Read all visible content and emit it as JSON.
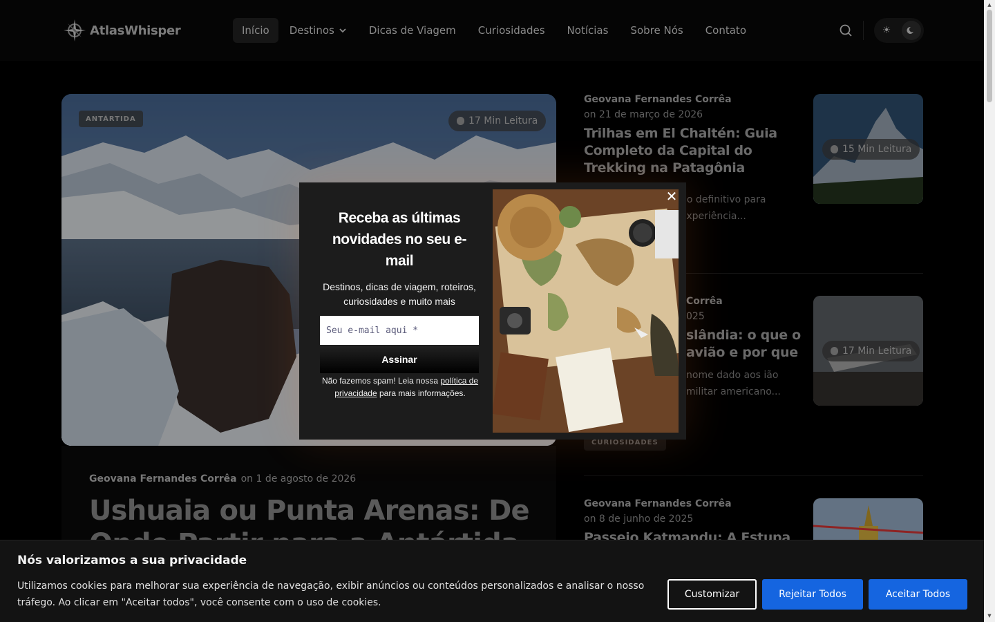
{
  "header": {
    "logo_text": "AtlasWhisper",
    "nav": [
      {
        "label": "Início",
        "active": true
      },
      {
        "label": "Destinos",
        "dropdown": true
      },
      {
        "label": "Dicas de Viagem"
      },
      {
        "label": "Curiosidades"
      },
      {
        "label": "Notícias"
      },
      {
        "label": "Sobre Nós"
      },
      {
        "label": "Contato"
      }
    ]
  },
  "hero": {
    "tag": "ANTÁRTIDA",
    "read_time": "17 Min Leitura",
    "author": "Geovana Fernandes Corrêa",
    "date": "on 1 de agosto de 2026",
    "title": "Ushuaia ou Punta Arenas: De Onde Partir para a Antártida"
  },
  "side_articles": [
    {
      "author": "Geovana Fernandes Corrêa",
      "date": "on 21 de março de 2026",
      "title": "Trilhas em El Chaltén: Guia Completo da Capital do Trekking na Patagônia",
      "excerpt": "no definitivo para experiência...",
      "read_time": "15 Min Leitura"
    },
    {
      "author": "Corrêa",
      "date": "025",
      "title": "slândia: o que o avião e por que",
      "excerpt": "nome dado aos ião militar americano...",
      "read_time": "17 Min Leitura",
      "category": "CURIOSIDADES"
    },
    {
      "author": "Geovana Fernandes Corrêa",
      "date": "on 8 de junho de 2025",
      "title": "Passeio Katmandu: A Estupa"
    }
  ],
  "newsletter": {
    "title": "Receba as últimas novidades no seu e-mail",
    "description": "Destinos, dicas de viagem, roteiros, curiosidades e muito mais",
    "email_placeholder": "Seu e-mail aqui *",
    "button": "Assinar",
    "note_prefix": "Não fazemos spam! Leia nossa ",
    "note_link": "política de privacidade",
    "note_suffix": " para mais informações.",
    "close": "✕"
  },
  "cookie": {
    "title": "Nós valorizamos a sua privacidade",
    "text": "Utilizamos cookies para melhorar sua experiência de navegação, exibir anúncios ou conteúdos personalizados e analisar o nosso tráfego. Ao clicar em \"Aceitar todos\", você consente com o uso de cookies.",
    "customize": "Customizar",
    "reject": "Rejeitar Todos",
    "accept": "Aceitar Todos",
    "accept_color": "#1565e0"
  }
}
